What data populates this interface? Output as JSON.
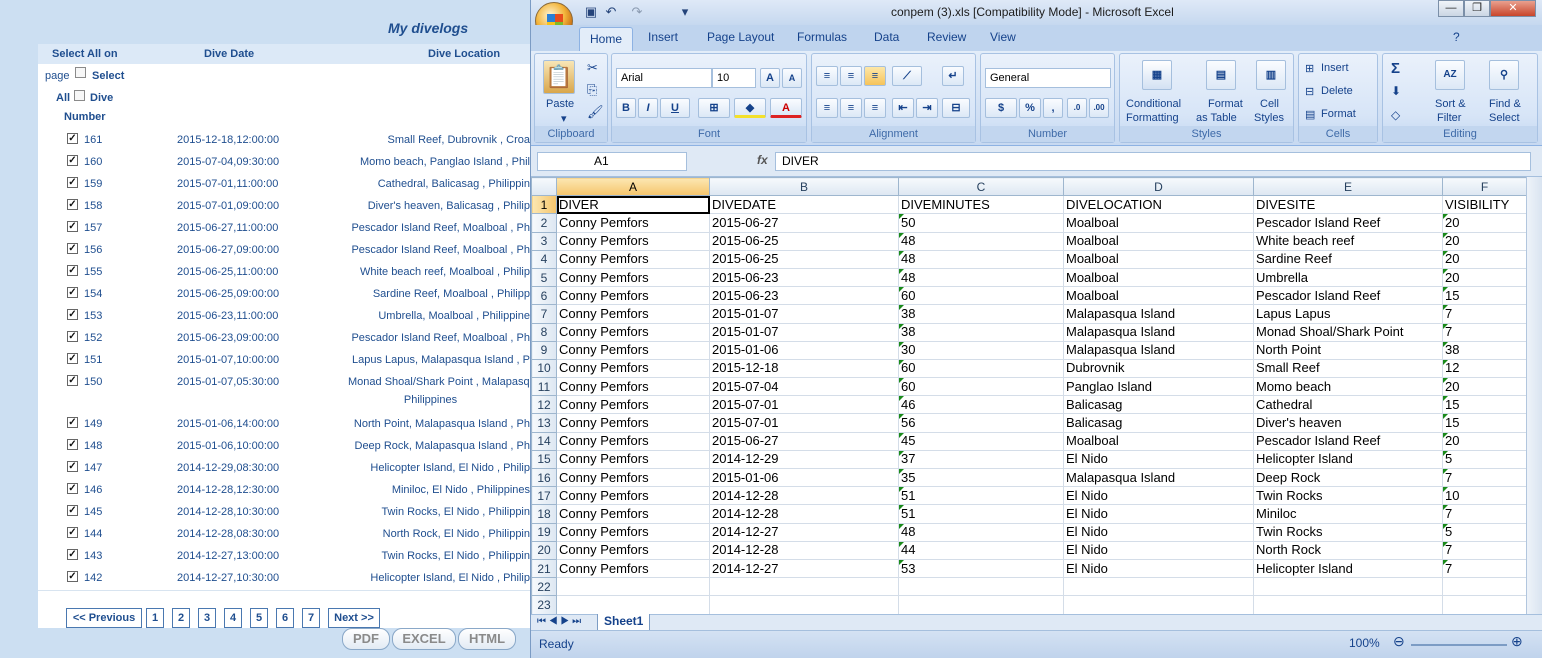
{
  "divelogs": {
    "title": "My divelogs",
    "select_all_label_1": "Select All on",
    "select_all_label_2": "page",
    "select_all_label_3": "Select",
    "select_all_label_4": "All",
    "dive_label": "Dive",
    "number_label": "Number",
    "col_date": "Dive Date",
    "col_location": "Dive Location",
    "rows": [
      {
        "num": "161",
        "date": "2015-12-18,12:00:00",
        "loc": "Small Reef, Dubrovnik , Croa",
        "checked": true
      },
      {
        "num": "160",
        "date": "2015-07-04,09:30:00",
        "loc": "Momo beach, Panglao Island , Phil",
        "checked": true
      },
      {
        "num": "159",
        "date": "2015-07-01,11:00:00",
        "loc": "Cathedral, Balicasag , Philippin",
        "checked": true
      },
      {
        "num": "158",
        "date": "2015-07-01,09:00:00",
        "loc": "Diver's heaven, Balicasag , Philip",
        "checked": true
      },
      {
        "num": "157",
        "date": "2015-06-27,11:00:00",
        "loc": "Pescador Island Reef, Moalboal , Ph",
        "checked": true
      },
      {
        "num": "156",
        "date": "2015-06-27,09:00:00",
        "loc": "Pescador Island Reef, Moalboal , Ph",
        "checked": true
      },
      {
        "num": "155",
        "date": "2015-06-25,11:00:00",
        "loc": "White beach reef, Moalboal , Philip",
        "checked": true
      },
      {
        "num": "154",
        "date": "2015-06-25,09:00:00",
        "loc": "Sardine Reef, Moalboal , Philipp",
        "checked": true
      },
      {
        "num": "153",
        "date": "2015-06-23,11:00:00",
        "loc": "Umbrella, Moalboal , Philippine",
        "checked": true
      },
      {
        "num": "152",
        "date": "2015-06-23,09:00:00",
        "loc": "Pescador Island Reef, Moalboal , Ph",
        "checked": true
      },
      {
        "num": "151",
        "date": "2015-01-07,10:00:00",
        "loc": "Lapus Lapus, Malapasqua Island , P",
        "checked": true
      },
      {
        "num": "150",
        "date": "2015-01-07,05:30:00",
        "loc": "Monad Shoal/Shark Point , Malapasqu",
        "loc2": "Philippines",
        "checked": true
      },
      {
        "num": "149",
        "date": "2015-01-06,14:00:00",
        "loc": "North Point, Malapasqua Island , Ph",
        "checked": true
      },
      {
        "num": "148",
        "date": "2015-01-06,10:00:00",
        "loc": "Deep Rock, Malapasqua Island , Ph",
        "checked": true
      },
      {
        "num": "147",
        "date": "2014-12-29,08:30:00",
        "loc": "Helicopter Island, El Nido , Philip",
        "checked": true
      },
      {
        "num": "146",
        "date": "2014-12-28,12:30:00",
        "loc": "Miniloc, El Nido , Philippines",
        "checked": true
      },
      {
        "num": "145",
        "date": "2014-12-28,10:30:00",
        "loc": "Twin Rocks, El Nido , Philippin",
        "checked": true
      },
      {
        "num": "144",
        "date": "2014-12-28,08:30:00",
        "loc": "North Rock, El Nido , Philippin",
        "checked": true
      },
      {
        "num": "143",
        "date": "2014-12-27,13:00:00",
        "loc": "Twin Rocks, El Nido , Philippin",
        "checked": true
      },
      {
        "num": "142",
        "date": "2014-12-27,10:30:00",
        "loc": "Helicopter Island, El Nido , Philip",
        "checked": true
      }
    ],
    "pager": [
      "<< Previous",
      "1",
      "2",
      "3",
      "4",
      "5",
      "6",
      "7",
      "Next >>"
    ],
    "export": [
      "PDF",
      "EXCEL",
      "HTML"
    ]
  },
  "excel": {
    "title": "conpem (3).xls  [Compatibility Mode] - Microsoft Excel",
    "tabs": [
      "Home",
      "Insert",
      "Page Layout",
      "Formulas",
      "Data",
      "Review",
      "View"
    ],
    "ribbon": {
      "paste": "Paste",
      "font_name": "Arial",
      "font_size": "10",
      "number_format": "General",
      "conditional": "Conditional",
      "formatting": "Formatting",
      "format_as": "Format",
      "as_table": "as Table",
      "cell": "Cell",
      "styles_btn": "Styles",
      "insert": "Insert",
      "delete": "Delete",
      "format": "Format",
      "sort": "Sort &",
      "filter": "Filter",
      "find": "Find &",
      "select": "Select",
      "groups": [
        "Clipboard",
        "Font",
        "Alignment",
        "Number",
        "Styles",
        "Cells",
        "Editing"
      ]
    },
    "name_box": "A1",
    "fx": "fx",
    "formula": "DIVER",
    "columns": [
      "A",
      "B",
      "C",
      "D",
      "E",
      "F"
    ],
    "header_row": [
      "DIVER",
      "DIVEDATE",
      "DIVEMINUTES",
      "DIVELOCATION",
      "DIVESITE",
      "VISIBILITY"
    ],
    "rows": [
      [
        "Conny Pemfors",
        "2015-06-27",
        "50",
        "Moalboal",
        "Pescador Island Reef",
        "20"
      ],
      [
        "Conny Pemfors",
        "2015-06-25",
        "48",
        "Moalboal",
        "White beach reef",
        "20"
      ],
      [
        "Conny Pemfors",
        "2015-06-25",
        "48",
        "Moalboal",
        "Sardine Reef",
        "20"
      ],
      [
        "Conny Pemfors",
        "2015-06-23",
        "48",
        "Moalboal",
        "Umbrella",
        "20"
      ],
      [
        "Conny Pemfors",
        "2015-06-23",
        "60",
        "Moalboal",
        "Pescador Island Reef",
        "15"
      ],
      [
        "Conny Pemfors",
        "2015-01-07",
        "38",
        "Malapasqua Island",
        "Lapus Lapus",
        "7"
      ],
      [
        "Conny Pemfors",
        "2015-01-07",
        "38",
        "Malapasqua Island",
        "Monad Shoal/Shark Point",
        "7"
      ],
      [
        "Conny Pemfors",
        "2015-01-06",
        "30",
        "Malapasqua Island",
        "North Point",
        "38"
      ],
      [
        "Conny Pemfors",
        "2015-12-18",
        "60",
        "Dubrovnik",
        "Small Reef",
        "12"
      ],
      [
        "Conny Pemfors",
        "2015-07-04",
        "60",
        "Panglao Island",
        "Momo beach",
        "20"
      ],
      [
        "Conny Pemfors",
        "2015-07-01",
        "46",
        "Balicasag",
        "Cathedral",
        "15"
      ],
      [
        "Conny Pemfors",
        "2015-07-01",
        "56",
        "Balicasag",
        "Diver's heaven",
        "15"
      ],
      [
        "Conny Pemfors",
        "2015-06-27",
        "45",
        "Moalboal",
        "Pescador Island Reef",
        "20"
      ],
      [
        "Conny Pemfors",
        "2014-12-29",
        "37",
        "El Nido",
        "Helicopter Island",
        "5"
      ],
      [
        "Conny Pemfors",
        "2015-01-06",
        "35",
        "Malapasqua Island",
        "Deep Rock",
        "7"
      ],
      [
        "Conny Pemfors",
        "2014-12-28",
        "51",
        "El Nido",
        "Twin Rocks",
        "10"
      ],
      [
        "Conny Pemfors",
        "2014-12-28",
        "51",
        "El Nido",
        "Miniloc",
        "7"
      ],
      [
        "Conny Pemfors",
        "2014-12-27",
        "48",
        "El Nido",
        "Twin Rocks",
        "5"
      ],
      [
        "Conny Pemfors",
        "2014-12-28",
        "44",
        "El Nido",
        "North Rock",
        "7"
      ],
      [
        "Conny Pemfors",
        "2014-12-27",
        "53",
        "El Nido",
        "Helicopter Island",
        "7"
      ]
    ],
    "row_numbers": [
      "1",
      "2",
      "3",
      "4",
      "5",
      "6",
      "7",
      "8",
      "9",
      "10",
      "11",
      "12",
      "13",
      "14",
      "15",
      "16",
      "17",
      "18",
      "19",
      "20",
      "21",
      "22",
      "23"
    ],
    "sheet_tab": "Sheet1",
    "status": "Ready",
    "zoom": "100%"
  }
}
